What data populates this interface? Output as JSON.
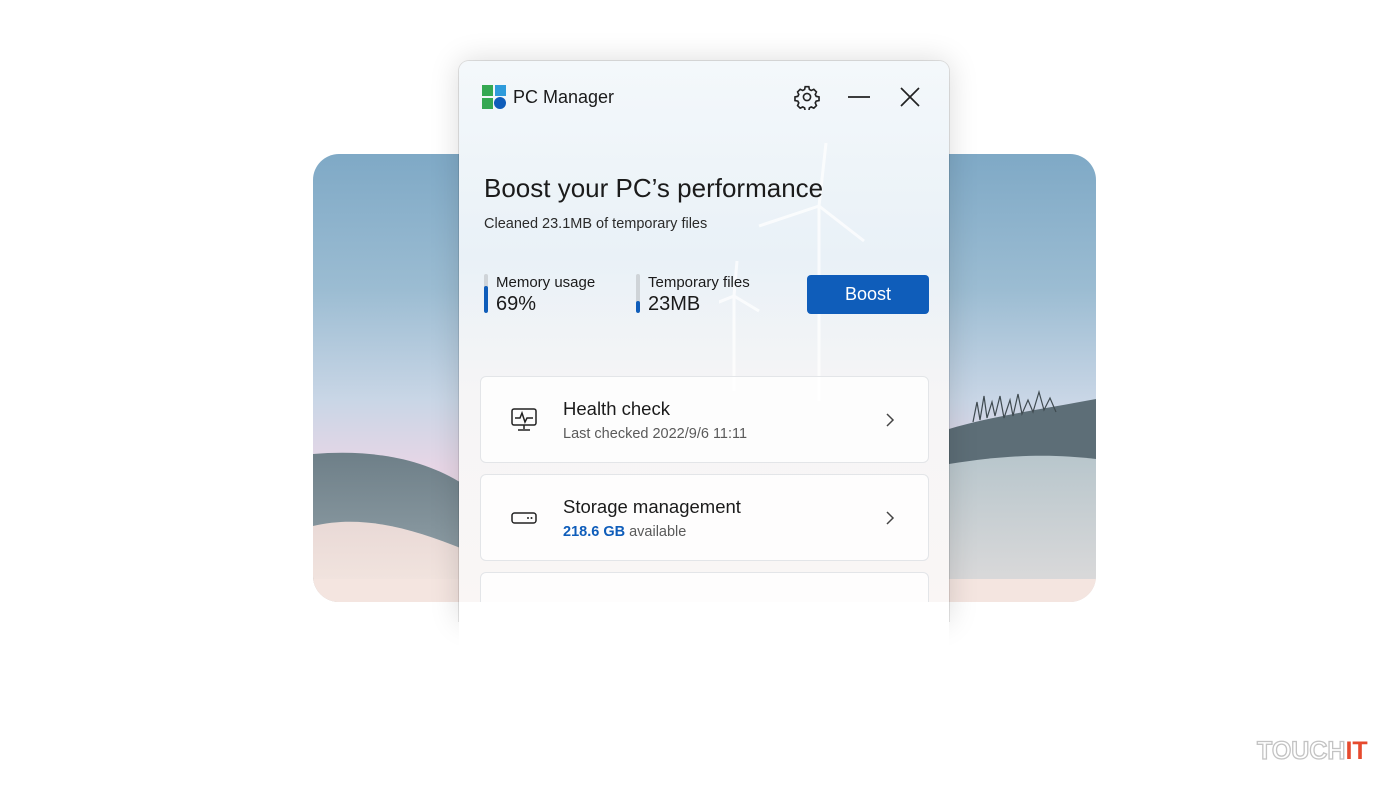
{
  "window": {
    "title": "PC Manager",
    "icons": [
      "app-logo-icon",
      "gear-icon",
      "minimize-icon",
      "close-icon"
    ]
  },
  "hero": {
    "title": "Boost your PC’s performance",
    "subtitle": "Cleaned 23.1MB of temporary files"
  },
  "stats": [
    {
      "label": "Memory usage",
      "value": "69%",
      "level": 0.69
    },
    {
      "label": "Temporary files",
      "value": "23MB",
      "level": 0.3
    }
  ],
  "boost_button": {
    "label": "Boost"
  },
  "cards": {
    "health": {
      "title": "Health check",
      "subtitle": "Last checked 2022/9/6 11:11",
      "icon": "health-monitor-icon"
    },
    "storage": {
      "title": "Storage management",
      "available_amount": "218.6 GB",
      "available_suffix": " available",
      "icon": "storage-drive-icon"
    }
  },
  "colors": {
    "accent": "#0f5dba",
    "watermark_red": "#e64a2e"
  },
  "watermark": {
    "part1": "TOUCH",
    "part2": "IT"
  }
}
